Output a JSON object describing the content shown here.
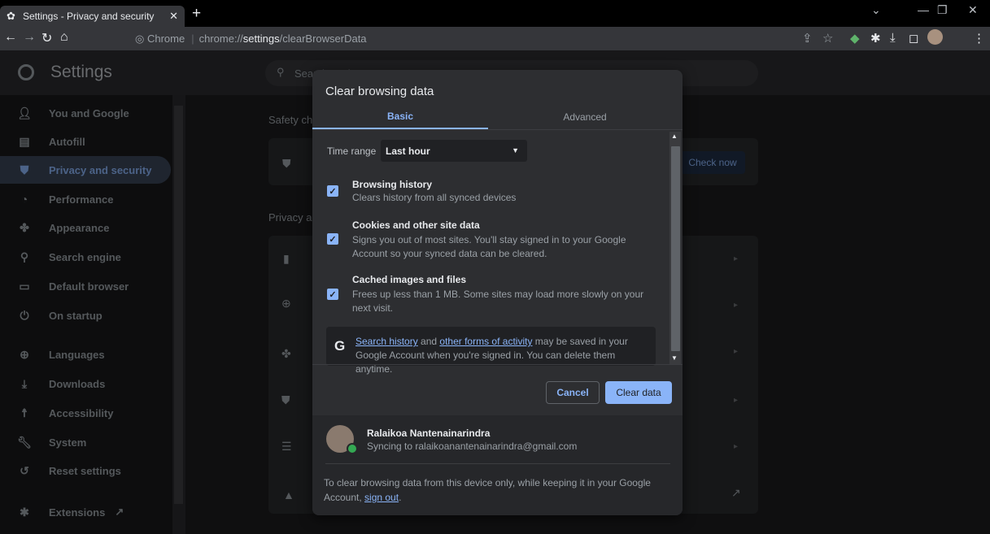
{
  "tab": {
    "title": "Settings - Privacy and security"
  },
  "omnibox": {
    "chip": "Chrome",
    "url_prefix": "chrome://",
    "url_host": "settings",
    "url_path": "/clearBrowserData"
  },
  "settings": {
    "title": "Settings",
    "search_placeholder": "Search settings"
  },
  "sidebar": {
    "items": [
      {
        "label": "You and Google",
        "icon": "person-icon"
      },
      {
        "label": "Autofill",
        "icon": "clipboard-icon"
      },
      {
        "label": "Privacy and security",
        "icon": "shield-icon"
      },
      {
        "label": "Performance",
        "icon": "gauge-icon"
      },
      {
        "label": "Appearance",
        "icon": "palette-icon"
      },
      {
        "label": "Search engine",
        "icon": "search-icon"
      },
      {
        "label": "Default browser",
        "icon": "browser-icon"
      },
      {
        "label": "On startup",
        "icon": "power-icon"
      },
      {
        "label": "Languages",
        "icon": "globe-icon"
      },
      {
        "label": "Downloads",
        "icon": "download-icon"
      },
      {
        "label": "Accessibility",
        "icon": "accessibility-icon"
      },
      {
        "label": "System",
        "icon": "wrench-icon"
      },
      {
        "label": "Reset settings",
        "icon": "reset-icon"
      },
      {
        "label": "Extensions",
        "icon": "puzzle-icon"
      }
    ]
  },
  "main": {
    "safety_check_heading": "Safety ch",
    "privacy_heading": "Privacy a",
    "check_now_label": "Check now"
  },
  "dialog": {
    "title": "Clear browsing data",
    "tabs": [
      "Basic",
      "Advanced"
    ],
    "time_range_label": "Time range",
    "time_range_value": "Last hour",
    "options": [
      {
        "title": "Browsing history",
        "desc": "Clears history from all synced devices",
        "checked": true
      },
      {
        "title": "Cookies and other site data",
        "desc": "Signs you out of most sites. You'll stay signed in to your Google Account so your synced data can be cleared.",
        "checked": true
      },
      {
        "title": "Cached images and files",
        "desc": "Frees up less than 1 MB. Some sites may load more slowly on your next visit.",
        "checked": true
      }
    ],
    "google_note": {
      "link1": "Search history",
      "mid": " and ",
      "link2": "other forms of activity",
      "rest": " may be saved in your Google Account when you're signed in. You can delete them anytime."
    },
    "cancel_label": "Cancel",
    "clear_label": "Clear data",
    "account": {
      "name": "Ralaikoa Nantenainarindra",
      "sync": "Syncing to ralaikoanantenainarindra@gmail.com"
    },
    "footer_note": {
      "text": "To clear browsing data from this device only, while keeping it in your Google Account, ",
      "link": "sign out",
      "end": "."
    }
  }
}
